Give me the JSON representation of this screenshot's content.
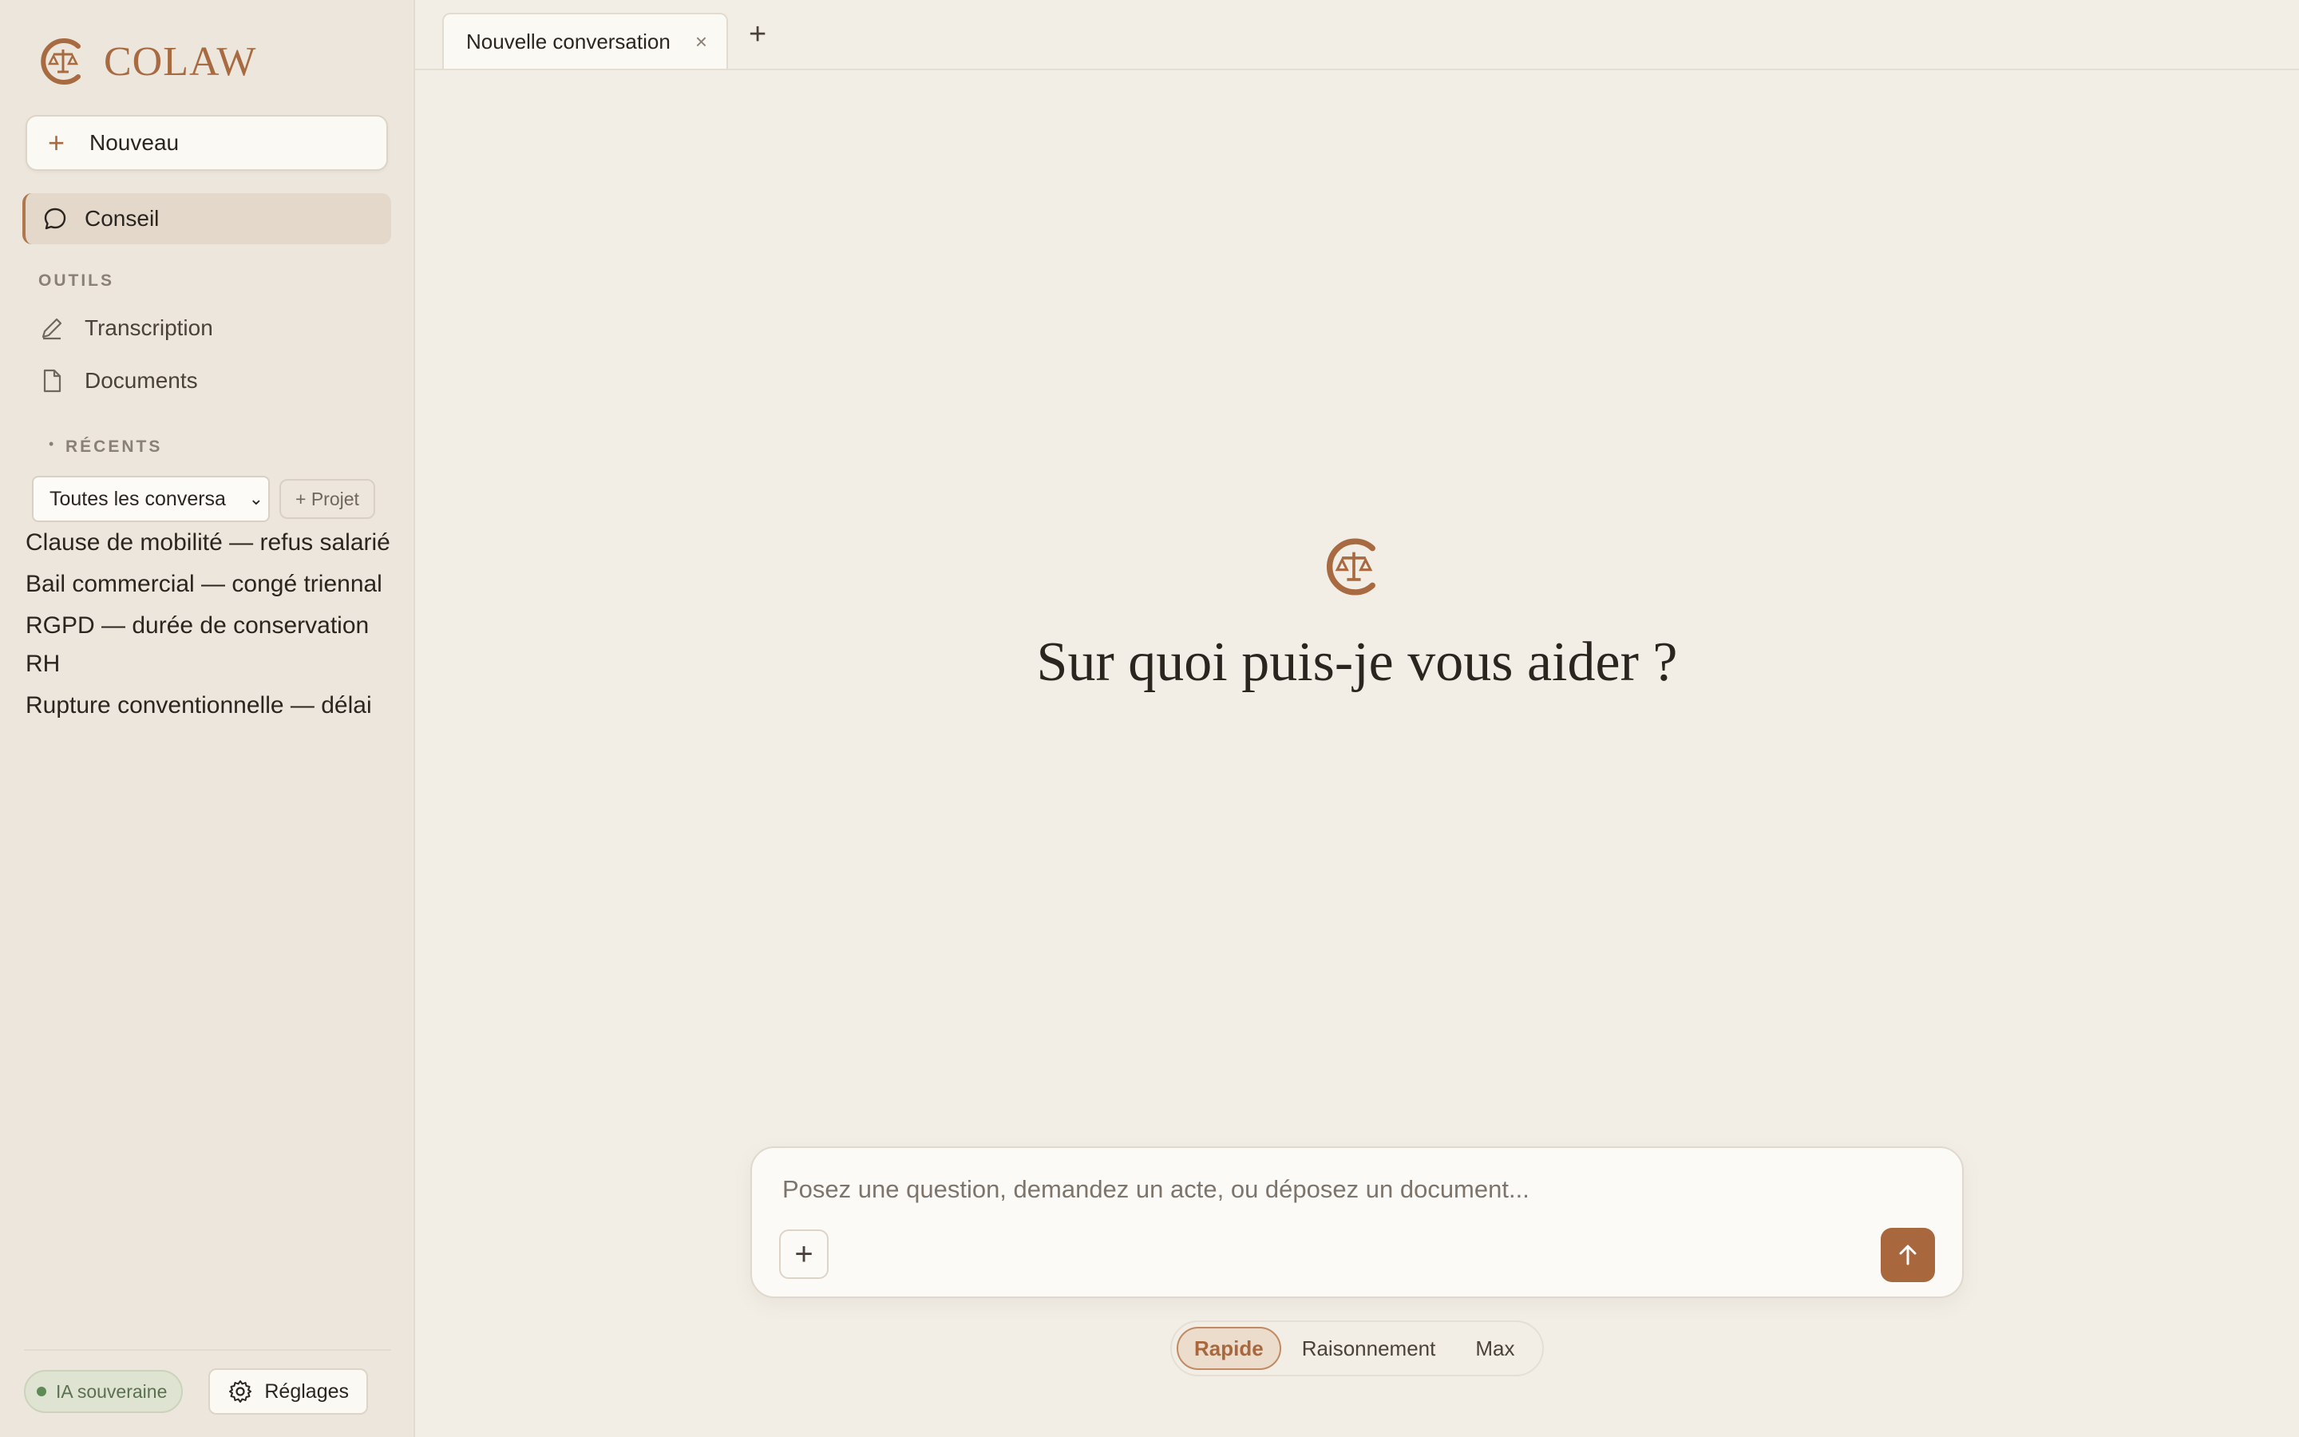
{
  "app": {
    "name": "COLAW"
  },
  "sidebar": {
    "new_label": "Nouveau",
    "active_item": "Conseil",
    "tools_title": "OUTILS",
    "tools": [
      {
        "label": "Transcription",
        "icon": "pencil-icon"
      },
      {
        "label": "Documents",
        "icon": "document-icon"
      }
    ],
    "recents_title": "RÉCENTS",
    "filter_value": "Toutes les conversa",
    "project_label": "+ Projet",
    "recents": [
      "Clause de mobilité — refus salarié",
      "Bail commercial — congé triennal",
      "RGPD — durée de conservation RH",
      "Rupture conventionnelle — délai"
    ],
    "sovereign_label": "IA souveraine",
    "settings_label": "Réglages"
  },
  "tabs": [
    {
      "label": "Nouvelle conversation",
      "close": "×"
    }
  ],
  "tab_add": "+",
  "hero": {
    "title": "Sur quoi puis-je vous aider ?"
  },
  "composer": {
    "placeholder": "Posez une question, demandez un acte, ou déposez un document..."
  },
  "modes": {
    "options": [
      "Rapide",
      "Raisonnement",
      "Max"
    ],
    "selected": "Rapide"
  },
  "colors": {
    "accent": "#a8673d",
    "sidebar_bg": "#ece6dc",
    "main_bg": "#f2eee6"
  }
}
